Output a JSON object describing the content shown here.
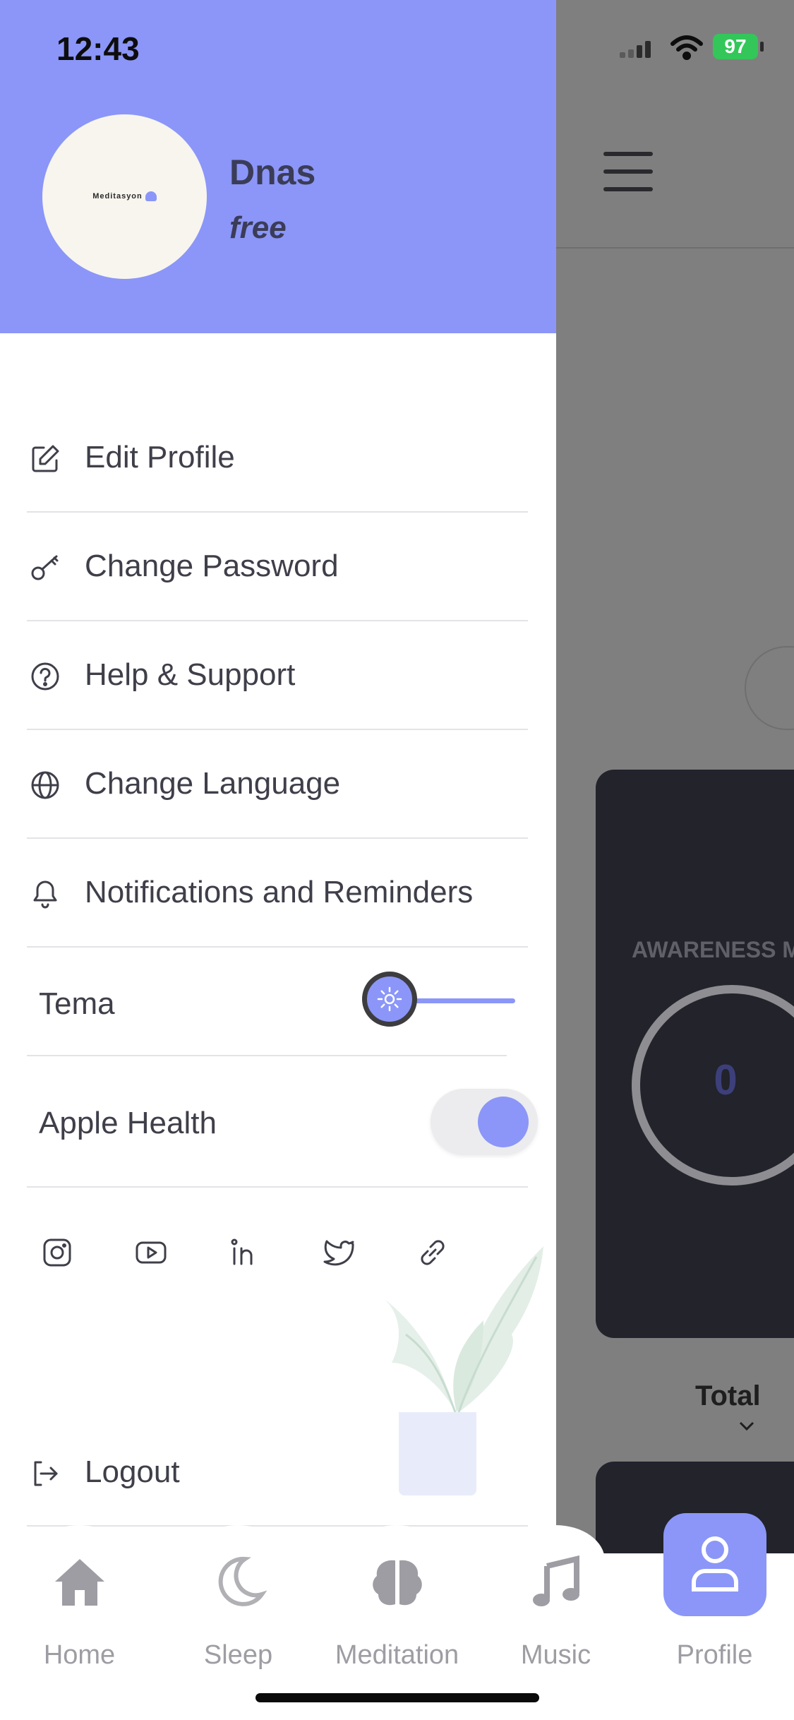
{
  "status_bar": {
    "time": "12:43",
    "battery": "97"
  },
  "profile": {
    "name": "Dnas",
    "plan": "free",
    "avatar_logo_text": "Meditasyon"
  },
  "menu": {
    "items": [
      {
        "label": "Edit Profile",
        "icon": "edit-icon"
      },
      {
        "label": "Change Password",
        "icon": "key-icon"
      },
      {
        "label": "Help & Support",
        "icon": "help-icon"
      },
      {
        "label": "Change Language",
        "icon": "globe-icon"
      },
      {
        "label": "Notifications and Reminders",
        "icon": "bell-icon"
      }
    ],
    "theme_label": "Tema",
    "theme_mode": "light",
    "apple_health_label": "Apple Health",
    "apple_health_enabled": true,
    "logout_label": "Logout"
  },
  "social_links": [
    "instagram-icon",
    "youtube-icon",
    "linkedin-icon",
    "twitter-icon",
    "link-icon"
  ],
  "background_screen": {
    "card_title": "AWARENESS MI",
    "ring_value": "0",
    "total_label": "Total"
  },
  "tabbar": {
    "tabs": [
      {
        "label": "Home",
        "icon": "home-icon"
      },
      {
        "label": "Sleep",
        "icon": "moon-icon"
      },
      {
        "label": "Meditation",
        "icon": "brain-icon"
      },
      {
        "label": "Music",
        "icon": "music-note-icon"
      },
      {
        "label": "Profile",
        "icon": "user-icon"
      }
    ],
    "active": "Profile"
  },
  "colors": {
    "accent": "#8b96f8",
    "text": "#3f3f4a",
    "dark_card": "#22232b"
  }
}
